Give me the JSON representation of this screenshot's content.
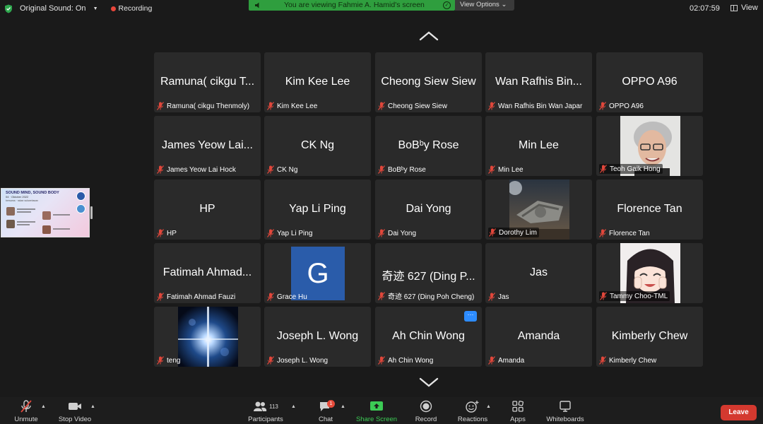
{
  "topbar": {
    "original_sound": "Original Sound: On",
    "recording": "Recording",
    "viewing_banner": "You are viewing Fahmie A. Hamid's screen",
    "view_options": "View Options ⌄",
    "time": "02:07:59",
    "view": "View"
  },
  "share_thumbnail": {
    "title": "SOUND MIND, SOUND BODY",
    "subtitle": "04 · Oktober 2022",
    "line": "bersama · rakan sukarelawan"
  },
  "tiles": [
    {
      "display": "Ramuna( cikgu T...",
      "name": "Ramuna( cikgu Thenmoly)"
    },
    {
      "display": "Kim Kee Lee",
      "name": "Kim Kee Lee"
    },
    {
      "display": "Cheong Siew Siew",
      "name": "Cheong Siew Siew"
    },
    {
      "display": "Wan Rafhis Bin...",
      "name": "Wan Rafhis Bin Wan Japar"
    },
    {
      "display": "OPPO A96",
      "name": "OPPO A96"
    },
    {
      "display": "James Yeow Lai...",
      "name": "James Yeow Lai Hock"
    },
    {
      "display": "CK Ng",
      "name": "CK Ng"
    },
    {
      "display": "BoBᵇy Rose",
      "name": "BoBᵇy Rose"
    },
    {
      "display": "Min Lee",
      "name": "Min Lee"
    },
    {
      "display": "",
      "name": "Teoh Gaik Hong",
      "photo": "portrait-photo"
    },
    {
      "display": "HP",
      "name": "HP"
    },
    {
      "display": "Yap Li Ping",
      "name": "Yap Li Ping"
    },
    {
      "display": "Dai Yong",
      "name": "Dai Yong"
    },
    {
      "display": "",
      "name": "Dorothy Lim",
      "photo": "spaceship-photo"
    },
    {
      "display": "Florence Tan",
      "name": "Florence Tan"
    },
    {
      "display": "Fatimah Ahmad...",
      "name": "Fatimah Ahmad Fauzi"
    },
    {
      "display": "",
      "name": "Grace Hu",
      "photo": "letter-avatar",
      "letter": "G"
    },
    {
      "display": "奇迹 627 (Ding P...",
      "name": "奇迹 627 (Ding Poh Cheng)"
    },
    {
      "display": "Jas",
      "name": "Jas"
    },
    {
      "display": "",
      "name": "Tammy Choo-TML",
      "photo": "anime-photo"
    },
    {
      "display": "",
      "name": "teng",
      "photo": "starlight-photo"
    },
    {
      "display": "Joseph L. Wong",
      "name": "Joseph L. Wong"
    },
    {
      "display": "Ah Chin Wong",
      "name": "Ah Chin Wong",
      "more_button": "···"
    },
    {
      "display": "Amanda",
      "name": "Amanda"
    },
    {
      "display": "Kimberly Chew",
      "name": "Kimberly Chew"
    }
  ],
  "toolbar": {
    "unmute": "Unmute",
    "stop_video": "Stop Video",
    "participants": "Participants",
    "participants_count": "113",
    "chat": "Chat",
    "chat_badge": "1",
    "share_screen": "Share Screen",
    "record": "Record",
    "reactions": "Reactions",
    "apps": "Apps",
    "whiteboards": "Whiteboards",
    "leave": "Leave"
  },
  "colors": {
    "accent_green": "#2f9e3e",
    "share_green": "#3ccb55",
    "leave_red": "#d4392f",
    "record_red": "#e8463a",
    "muted_mic_red": "#e0473b",
    "tile_bg": "#2a2a2a"
  }
}
